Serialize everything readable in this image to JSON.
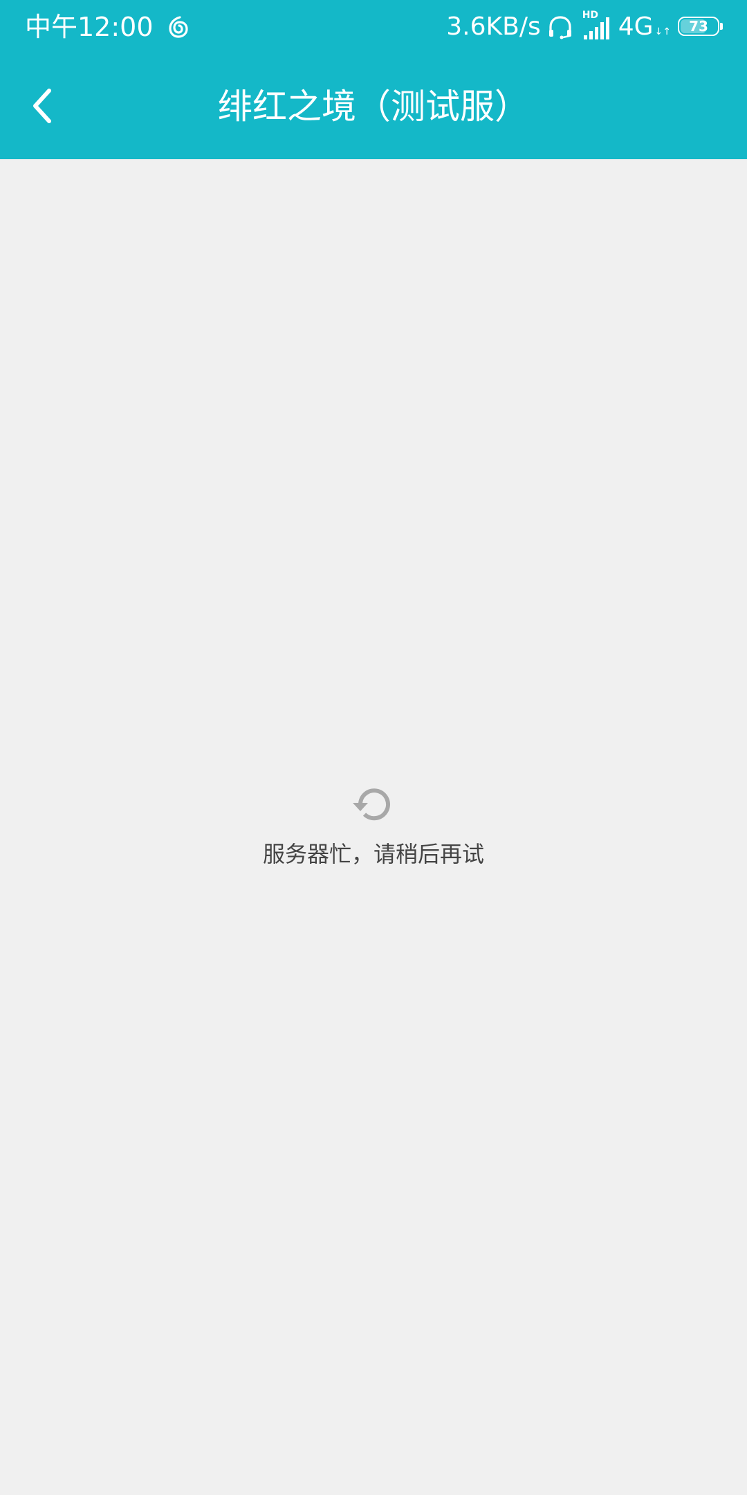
{
  "status_bar": {
    "time": "中午12:00",
    "app_icon": "netease-music-icon",
    "net_speed": "3.6KB/s",
    "headset_icon": "headset-icon",
    "hd_label": "HD",
    "network_type": "4G",
    "net_arrows": "↓↑",
    "battery_level": "73",
    "battery_fraction": 0.73
  },
  "title_bar": {
    "back_icon": "chevron-left-icon",
    "title": "绯红之境（测试服）"
  },
  "error_state": {
    "refresh_icon": "refresh-icon",
    "message": "服务器忙，请稍后再试"
  },
  "colors": {
    "header_background": "#14b8c8",
    "page_background": "#f0f0f0",
    "error_text": "#444444",
    "refresh_icon": "#a8a8a8"
  }
}
